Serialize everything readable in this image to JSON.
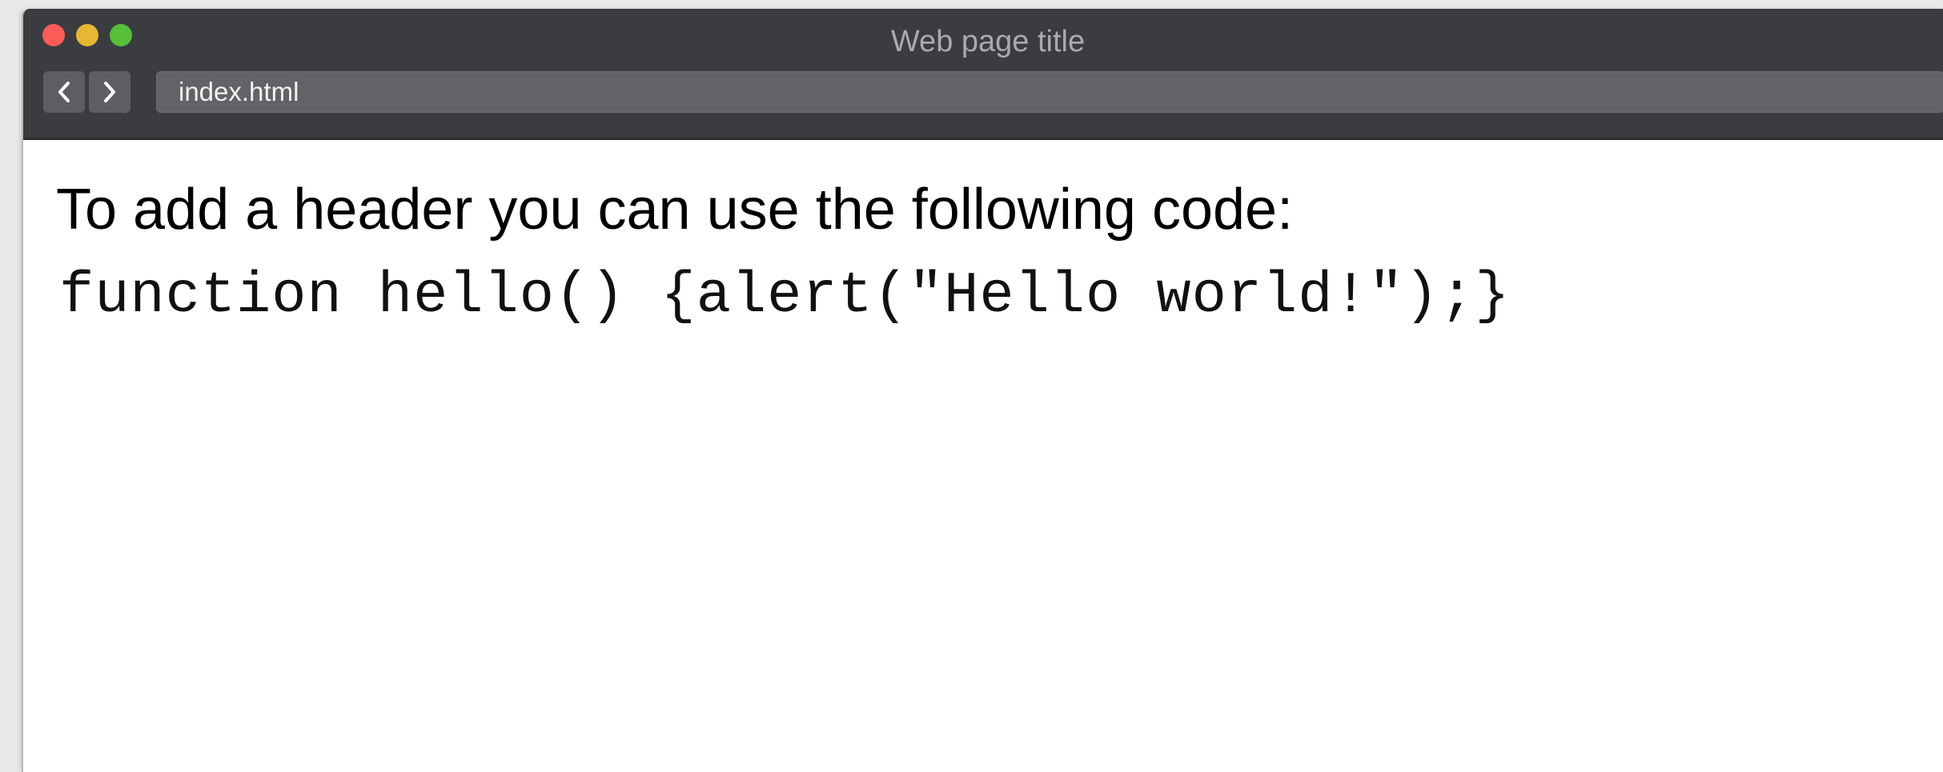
{
  "window": {
    "title": "Web page title"
  },
  "toolbar": {
    "back_icon": "chevron-left-icon",
    "forward_icon": "chevron-right-icon",
    "address": "index.html"
  },
  "page": {
    "heading": "To add a header you can use the following code:",
    "code": "function hello() {alert(\"Hello world!\");}"
  },
  "colors": {
    "chrome": "#3b3c40",
    "close": "#fc5b57",
    "minimize": "#e6b634",
    "maximize": "#57c038",
    "address_bar": "#626366",
    "content_bg": "#ffffff"
  }
}
